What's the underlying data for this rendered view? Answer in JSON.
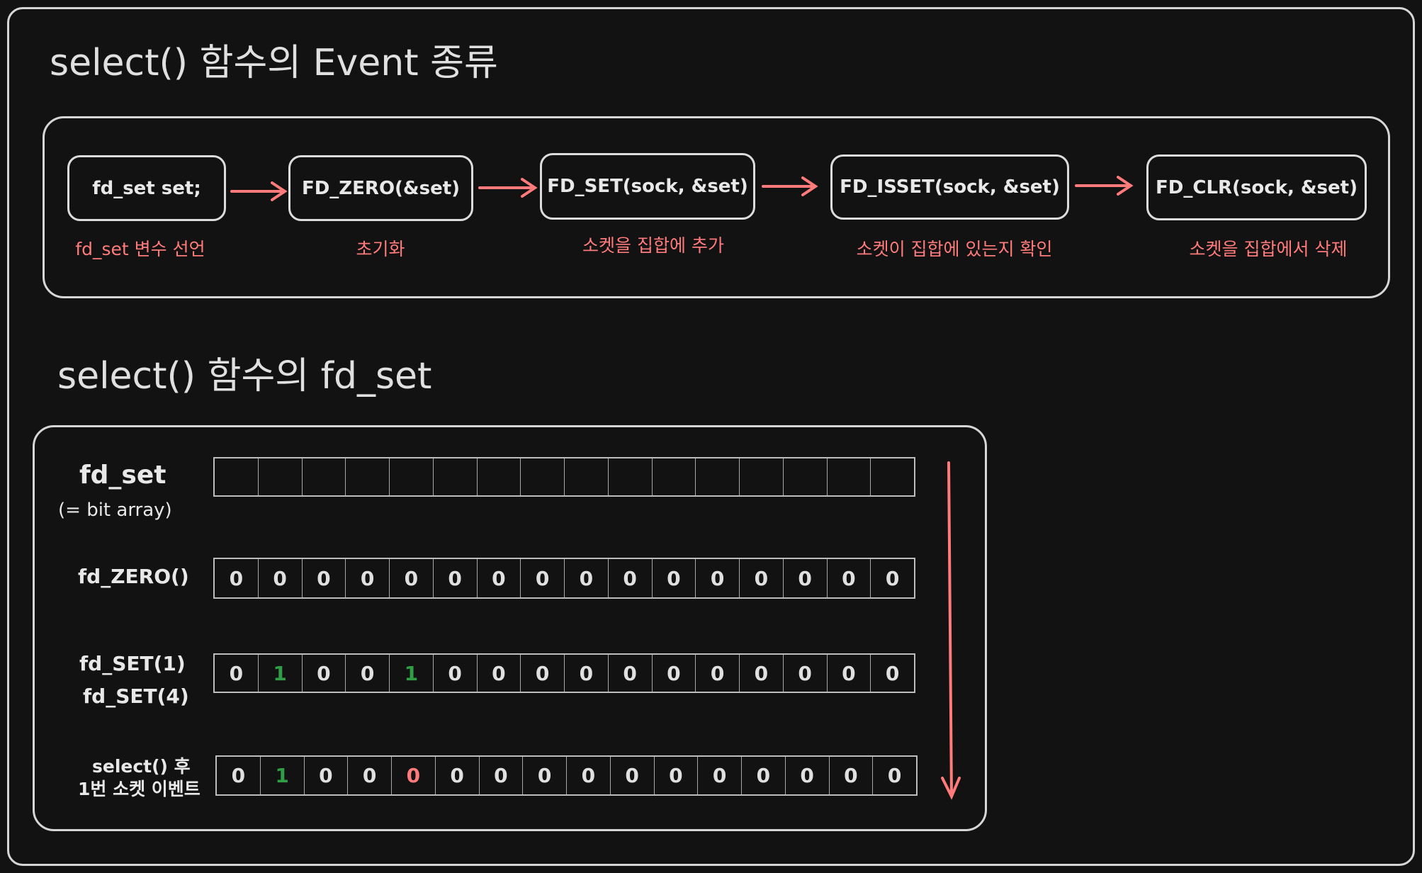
{
  "section1": {
    "title": "select() 함수의 Event 종류",
    "steps": [
      {
        "label": "fd_set set;",
        "caption": "fd_set 변수 선언"
      },
      {
        "label": "FD_ZERO(&set)",
        "caption": "초기화"
      },
      {
        "label": "FD_SET(sock, &set)",
        "caption": "소켓을 집합에 추가"
      },
      {
        "label": "FD_ISSET(sock, &set)",
        "caption": "소켓이 집합에 있는지 확인"
      },
      {
        "label": "FD_CLR(sock, &set)",
        "caption": "소켓을 집합에서 삭제"
      }
    ]
  },
  "section2": {
    "title": "select() 함수의 fd_set",
    "rows": [
      {
        "label": "fd_set",
        "sublabel": "(= bit array)",
        "bits": [
          "",
          "",
          "",
          "",
          "",
          "",
          "",
          "",
          "",
          "",
          "",
          "",
          "",
          "",
          "",
          ""
        ]
      },
      {
        "label": "fd_ZERO()",
        "bits": [
          "0",
          "0",
          "0",
          "0",
          "0",
          "0",
          "0",
          "0",
          "0",
          "0",
          "0",
          "0",
          "0",
          "0",
          "0",
          "0"
        ]
      },
      {
        "label": "fd_SET(1)",
        "label2": "fd_SET(4)",
        "bits": [
          "0",
          "1",
          "0",
          "0",
          "1",
          "0",
          "0",
          "0",
          "0",
          "0",
          "0",
          "0",
          "0",
          "0",
          "0",
          "0"
        ],
        "highlight": {
          "1": "green",
          "4": "green"
        }
      },
      {
        "label": "select() 후",
        "label2": "1번 소켓 이벤트",
        "bits": [
          "0",
          "1",
          "0",
          "0",
          "0",
          "0",
          "0",
          "0",
          "0",
          "0",
          "0",
          "0",
          "0",
          "0",
          "0",
          "0"
        ],
        "highlight": {
          "1": "green",
          "4": "red"
        }
      }
    ]
  },
  "colors": {
    "background": "#121212",
    "stroke": "#d6d6d6",
    "accent_red": "#ff7b7b",
    "green": "#2f9e44"
  }
}
